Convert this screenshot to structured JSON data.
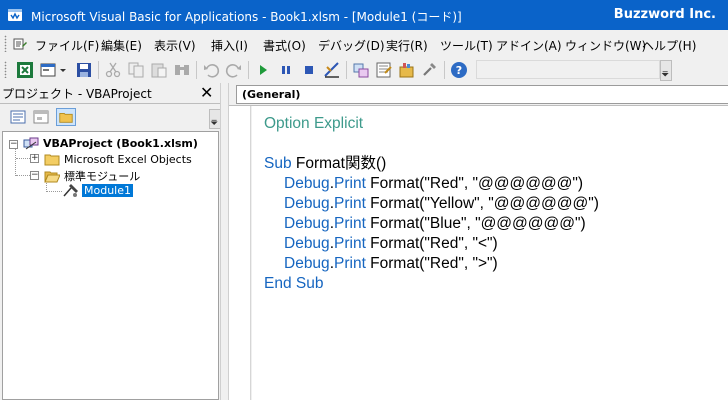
{
  "window": {
    "title": "Microsoft Visual Basic for Applications - Book1.xlsm - [Module1 (コード)]",
    "brand": "Buzzword Inc."
  },
  "menu": {
    "items": [
      {
        "label": "ファイル(F)"
      },
      {
        "label": "編集(E)"
      },
      {
        "label": "表示(V)"
      },
      {
        "label": "挿入(I)"
      },
      {
        "label": "書式(O)"
      },
      {
        "label": "デバッグ(D)"
      },
      {
        "label": "実行(R)"
      },
      {
        "label": "ツール(T)"
      },
      {
        "label": "アドイン(A)"
      },
      {
        "label": "ウィンドウ(W)"
      },
      {
        "label": "ヘルプ(H)"
      }
    ]
  },
  "toolbar": {
    "icons": [
      "excel-view-icon",
      "insert-userform-icon",
      "save-icon",
      "cut-icon",
      "copy-icon",
      "paste-icon",
      "find-icon",
      "undo-icon",
      "redo-icon",
      "run-icon",
      "break-icon",
      "reset-icon",
      "design-mode-icon",
      "project-explorer-icon",
      "properties-icon",
      "object-browser-icon",
      "toolbox-icon",
      "help-icon"
    ]
  },
  "project": {
    "pane_title": "プロジェクト - VBAProject",
    "root": "VBAProject (Book1.xlsm)",
    "excel_objects": "Microsoft Excel Objects",
    "standard_modules": "標準モジュール",
    "module": "Module1"
  },
  "code": {
    "object_dropdown": "(General)",
    "lines": {
      "l1": {
        "kw": "Option Explicit"
      },
      "l3": {
        "kw": "Sub",
        "rest": " Format関数()"
      },
      "l4": {
        "kw1": "Debug",
        "dot": ".",
        "kw2": "Print",
        "rest": " Format(\"Red\", \"@@@@@@\")"
      },
      "l5": {
        "kw1": "Debug",
        "dot": ".",
        "kw2": "Print",
        "rest": " Format(\"Yellow\", \"@@@@@@\")"
      },
      "l6": {
        "kw1": "Debug",
        "dot": ".",
        "kw2": "Print",
        "rest": " Format(\"Blue\", \"@@@@@@\")"
      },
      "l7": {
        "kw1": "Debug",
        "dot": ".",
        "kw2": "Print",
        "rest": " Format(\"Red\", \"<\")"
      },
      "l8": {
        "kw1": "Debug",
        "dot": ".",
        "kw2": "Print",
        "rest": " Format(\"Red\", \">\")"
      },
      "l9": {
        "kw": "End Sub"
      }
    }
  },
  "colors": {
    "titlebar": "#0a63c9",
    "keyword": "#1565c0",
    "option_explicit": "#3d9a8b",
    "selection": "#0078d7"
  }
}
